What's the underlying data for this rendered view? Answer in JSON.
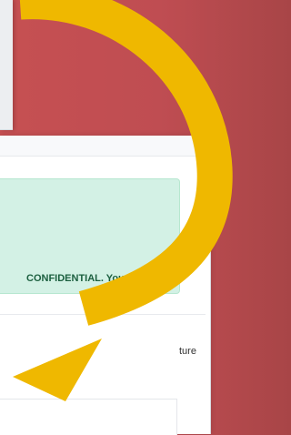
{
  "alert": {
    "text": "CONFIDENTIAL. Your"
  },
  "content": {
    "truncated_text": "ture"
  },
  "colors": {
    "background": "#c65052",
    "alert_background": "#d3f1e5",
    "alert_text": "#1b5f3f",
    "arrow": "#efb800"
  },
  "icons": {
    "annotation": "curved-arrow-icon"
  }
}
